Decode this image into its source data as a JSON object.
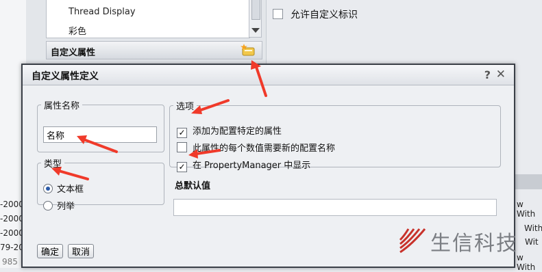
{
  "background": {
    "list_items": [
      "Thread Display",
      "彩色"
    ],
    "section_title": "自定义属性",
    "allow_custom_label": "允许自定义标识",
    "left_fragments": [
      "-2000",
      "-2000",
      "-2000",
      "79-20",
      "985"
    ],
    "right_fragments": [
      "w With",
      "With",
      "Wit",
      "w With"
    ]
  },
  "dialog": {
    "title": "自定义属性定义",
    "help": "?",
    "close": "✕",
    "name_group": {
      "legend": "属性名称",
      "value": "名称"
    },
    "type_group": {
      "legend": "类型",
      "options": [
        "文本框",
        "列举"
      ],
      "selected": "文本框"
    },
    "options_group": {
      "legend": "选项",
      "items": [
        {
          "label": "添加为配置特定的属性",
          "checked": true
        },
        {
          "label": "此属性的每个数值需要新的配置名称",
          "checked": false
        },
        {
          "label": "在 PropertyManager 中显示",
          "checked": true
        }
      ]
    },
    "default_value_label": "总默认值",
    "default_value": "",
    "ok": "确定",
    "cancel": "取消"
  },
  "watermark": {
    "text": "生信科技"
  },
  "colors": {
    "annotation_arrow": "#f03a2a",
    "watermark": "#c8322b"
  }
}
